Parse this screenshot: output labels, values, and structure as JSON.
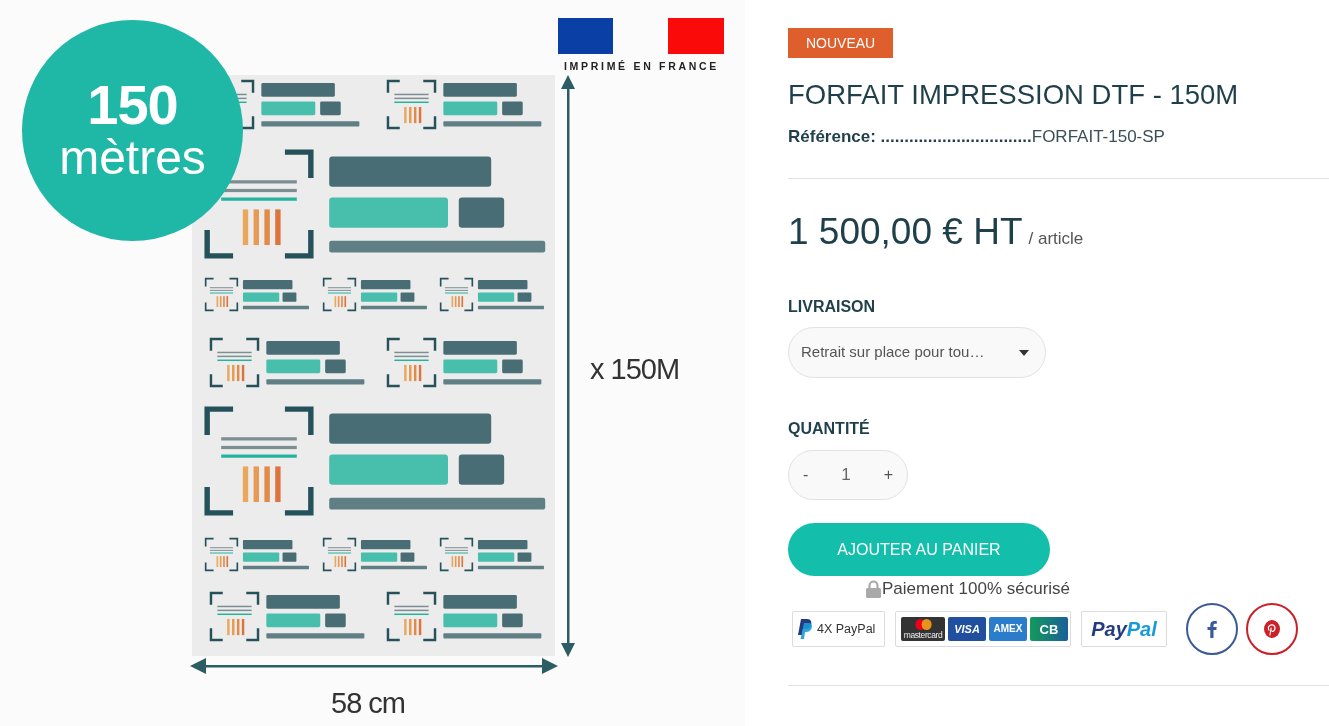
{
  "product_image": {
    "length_badge": {
      "number": "150",
      "unit": "mètres"
    },
    "flag_caption": "IMPRIMÉ EN FRANCE",
    "height_label": "x 150M",
    "width_label": "58 cm"
  },
  "product": {
    "badge": "NOUVEAU",
    "title": "FORFAIT IMPRESSION DTF - 150M",
    "reference_label": "Référence: ................................",
    "reference": "FORFAIT-150-SP",
    "price": "1 500,00 € HT",
    "price_unit": "/ article"
  },
  "delivery": {
    "label": "LIVRAISON",
    "value": "Retrait sur place pour tou…"
  },
  "quantity": {
    "label": "QUANTITÉ",
    "decrement": "-",
    "value": "1",
    "increment": "+"
  },
  "add_to_cart": "AJOUTER AU PANIER",
  "secure_payment": "Paiement 100% sécurisé",
  "payment_badges": [
    {
      "kind": "installments",
      "label": "4X PayPal"
    },
    {
      "kind": "cards",
      "cards": [
        {
          "kind": "mastercard",
          "label": "mastercard"
        },
        {
          "kind": "visa",
          "label": "VISA"
        },
        {
          "kind": "amex",
          "label": "AMEX"
        },
        {
          "kind": "cb",
          "label": "CB"
        }
      ]
    },
    {
      "kind": "wallet",
      "parts": [
        "Pay",
        "Pal"
      ]
    }
  ],
  "share": [
    {
      "kind": "facebook"
    },
    {
      "kind": "pinterest"
    }
  ]
}
